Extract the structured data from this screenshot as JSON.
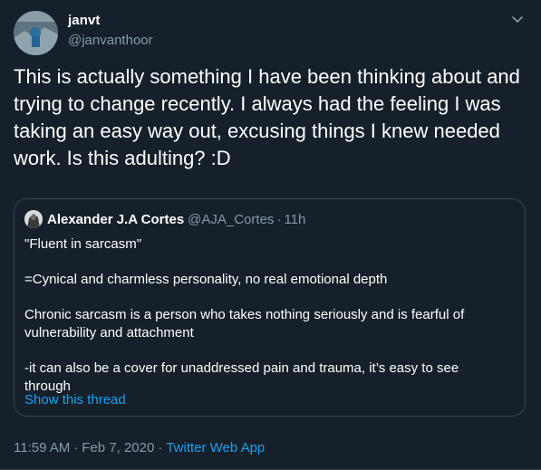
{
  "author": {
    "display_name": "janvt",
    "handle": "@janvanthoor",
    "avatar_icon": "avatar-photo-icon"
  },
  "menu_icon": "chevron-down-icon",
  "tweet": {
    "text": "This is actually something I have been thinking about and trying to change recently. I always had the feeling I was taking an easy way out, excusing things I knew needed work. Is this adulting? :D"
  },
  "quoted_tweet": {
    "author_name": "Alexander J.A Cortes",
    "author_handle": "@AJA_Cortes",
    "separator": "·",
    "time": "11h",
    "paragraphs": [
      "\"Fluent in sarcasm\"",
      "=Cynical and charmless personality, no real emotional depth",
      "Chronic sarcasm is a person who takes nothing seriously and is fearful of vulnerability and attachment",
      "-it can also be a cover for unaddressed pain and trauma, it’s easy to see through"
    ],
    "show_thread_label": "Show this thread"
  },
  "metadata": {
    "time": "11:59 AM",
    "separator_1": "·",
    "date": "Feb 7, 2020",
    "separator_2": "·",
    "source": "Twitter Web App"
  },
  "colors": {
    "background": "#15202b",
    "text_primary": "#ffffff",
    "text_secondary": "#8899a6",
    "link": "#1da1f2",
    "border": "#38444d"
  }
}
